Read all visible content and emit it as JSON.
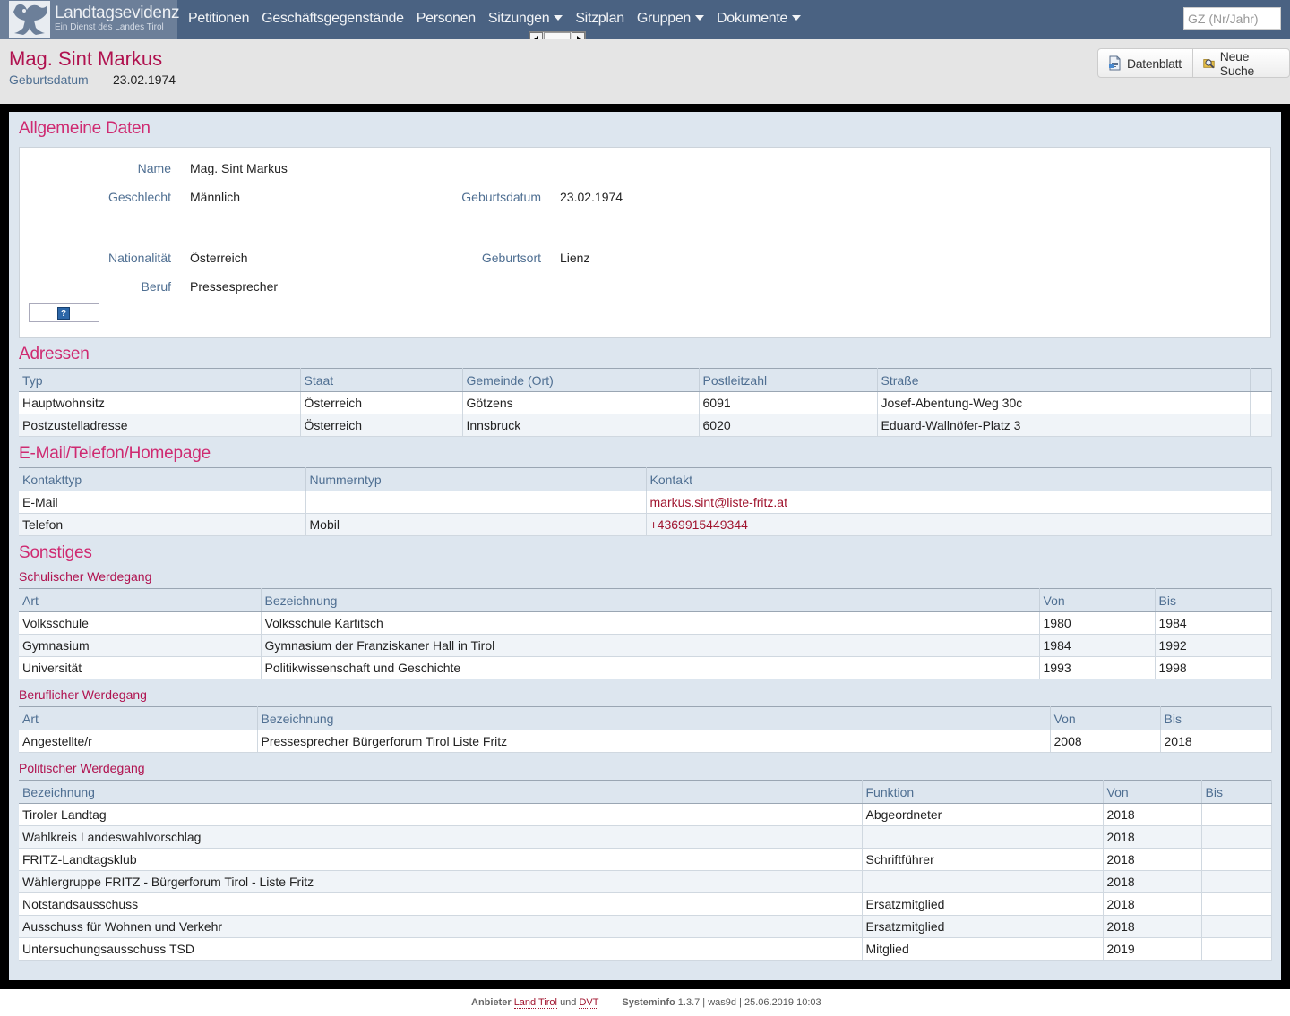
{
  "nav": {
    "brand_title": "Landtagsevidenz",
    "brand_subtitle": "Ein Dienst des Landes Tirol",
    "items": [
      {
        "label": "Petitionen",
        "dropdown": false
      },
      {
        "label": "Geschäftsgegenstände",
        "dropdown": false
      },
      {
        "label": "Personen",
        "dropdown": false
      },
      {
        "label": "Sitzungen",
        "dropdown": true
      },
      {
        "label": "Sitzplan",
        "dropdown": false
      },
      {
        "label": "Gruppen",
        "dropdown": true
      },
      {
        "label": "Dokumente",
        "dropdown": true
      }
    ],
    "search_placeholder": "GZ (Nr/Jahr)"
  },
  "header": {
    "title": "Mag. Sint Markus",
    "birth_label": "Geburtsdatum",
    "birth_value": "23.02.1974",
    "btn_datenblatt": "Datenblatt",
    "btn_neue_suche": "Neue Suche"
  },
  "general": {
    "title": "Allgemeine Daten",
    "name_label": "Name",
    "name_value": "Mag. Sint Markus",
    "gender_label": "Geschlecht",
    "gender_value": "Männlich",
    "birth_label": "Geburtsdatum",
    "birth_value": "23.02.1974",
    "nationality_label": "Nationalität",
    "nationality_value": "Österreich",
    "birthplace_label": "Geburtsort",
    "birthplace_value": "Lienz",
    "job_label": "Beruf",
    "job_value": "Pressesprecher",
    "help_glyph": "?"
  },
  "addresses": {
    "title": "Adressen",
    "columns": [
      "Typ",
      "Staat",
      "Gemeinde (Ort)",
      "Postleitzahl",
      "Straße"
    ],
    "rows": [
      [
        "Hauptwohnsitz",
        "Österreich",
        "Götzens",
        "6091",
        "Josef-Abentung-Weg 30c"
      ],
      [
        "Postzustelladresse",
        "Österreich",
        "Innsbruck",
        "6020",
        "Eduard-Wallnöfer-Platz 3"
      ]
    ]
  },
  "contact": {
    "title": "E-Mail/Telefon/Homepage",
    "columns": [
      "Kontakttyp",
      "Nummerntyp",
      "Kontakt"
    ],
    "rows": [
      [
        "E-Mail",
        "",
        "markus.sint@liste-fritz.at"
      ],
      [
        "Telefon",
        "Mobil",
        "+4369915449344"
      ]
    ]
  },
  "misc": {
    "title": "Sonstiges",
    "school": {
      "title": "Schulischer Werdegang",
      "columns": [
        "Art",
        "Bezeichnung",
        "Von",
        "Bis"
      ],
      "rows": [
        [
          "Volksschule",
          "Volksschule Kartitsch",
          "1980",
          "1984"
        ],
        [
          "Gymnasium",
          "Gymnasium der Franziskaner Hall in Tirol",
          "1984",
          "1992"
        ],
        [
          "Universität",
          "Politikwissenschaft und Geschichte",
          "1993",
          "1998"
        ]
      ]
    },
    "career": {
      "title": "Beruflicher Werdegang",
      "columns": [
        "Art",
        "Bezeichnung",
        "Von",
        "Bis"
      ],
      "rows": [
        [
          "Angestellte/r",
          "Pressesprecher Bürgerforum Tirol Liste Fritz",
          "2008",
          "2018"
        ]
      ]
    },
    "political": {
      "title": "Politischer Werdegang",
      "columns": [
        "Bezeichnung",
        "Funktion",
        "Von",
        "Bis"
      ],
      "rows": [
        [
          "Tiroler Landtag",
          "Abgeordneter",
          "2018",
          ""
        ],
        [
          "Wahlkreis Landeswahlvorschlag",
          "",
          "2018",
          ""
        ],
        [
          "FRITZ-Landtagsklub",
          "Schriftführer",
          "2018",
          ""
        ],
        [
          "Wählergruppe FRITZ - Bürgerforum Tirol - Liste Fritz",
          "",
          "2018",
          ""
        ],
        [
          "Notstandsausschuss",
          "Ersatzmitglied",
          "2018",
          ""
        ],
        [
          "Ausschuss für Wohnen und Verkehr",
          "Ersatzmitglied",
          "2018",
          ""
        ],
        [
          "Untersuchungsausschuss TSD",
          "Mitglied",
          "2019",
          ""
        ]
      ]
    }
  },
  "footer": {
    "provider_label": "Anbieter",
    "link_land": "Land Tirol",
    "and": "und",
    "link_dvt": "DVT",
    "sysinfo_label": "Systeminfo",
    "sysinfo_value": "1.3.7 | was9d | 25.06.2019 10:03"
  }
}
